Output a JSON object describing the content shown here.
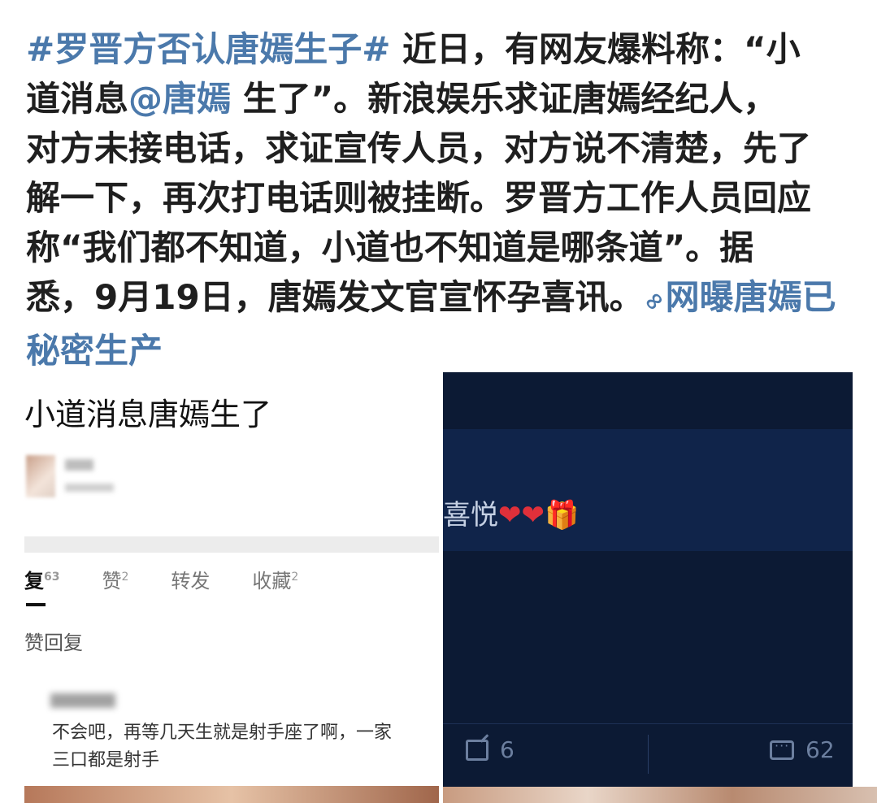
{
  "post": {
    "line1": {
      "hashtag": "#罗晋方否认唐嫣生子#",
      "text": " 近日，有网友爆料称：“小"
    },
    "line2": {
      "pre": "道消息",
      "mention": "@唐嫣",
      "post": " 生了”。新浪娱乐求证唐嫣经纪人，"
    },
    "line3": "对方未接电话，求证宣传人员，对方说不清楚，先了",
    "line4": "解一下，再次打电话则被挂断。罗晋方工作人员回应",
    "line5": "称“我们都不知道，小道也不知道是哪条道”。据",
    "line6": {
      "text": "悉，9月19日，唐嫣发文官宣怀孕喜讯。",
      "link_icon": "∞",
      "link_label": "网曝唐嫣已"
    },
    "line7": "秘密生产"
  },
  "left_screenshot": {
    "title": "小道消息唐嫣生了",
    "tabs": [
      {
        "label": "复",
        "count": "63"
      },
      {
        "label": "赞",
        "count": "2"
      },
      {
        "label": "转发",
        "count": ""
      },
      {
        "label": "收藏",
        "count": "2"
      }
    ],
    "sort_label": "赞回复",
    "comment_line1": "不会吧，再等几天生就是射手座了啊，一家",
    "comment_line2": "三口都是射手"
  },
  "right_screenshot": {
    "text": "喜悦",
    "hearts": "❤❤",
    "gift": "🎁",
    "share_count": "6",
    "comment_count": "62",
    "colors": {
      "background": "#0c1a34",
      "band": "#10244a"
    }
  },
  "colors": {
    "link": "#4b79ab",
    "text": "#1f1f1f"
  }
}
